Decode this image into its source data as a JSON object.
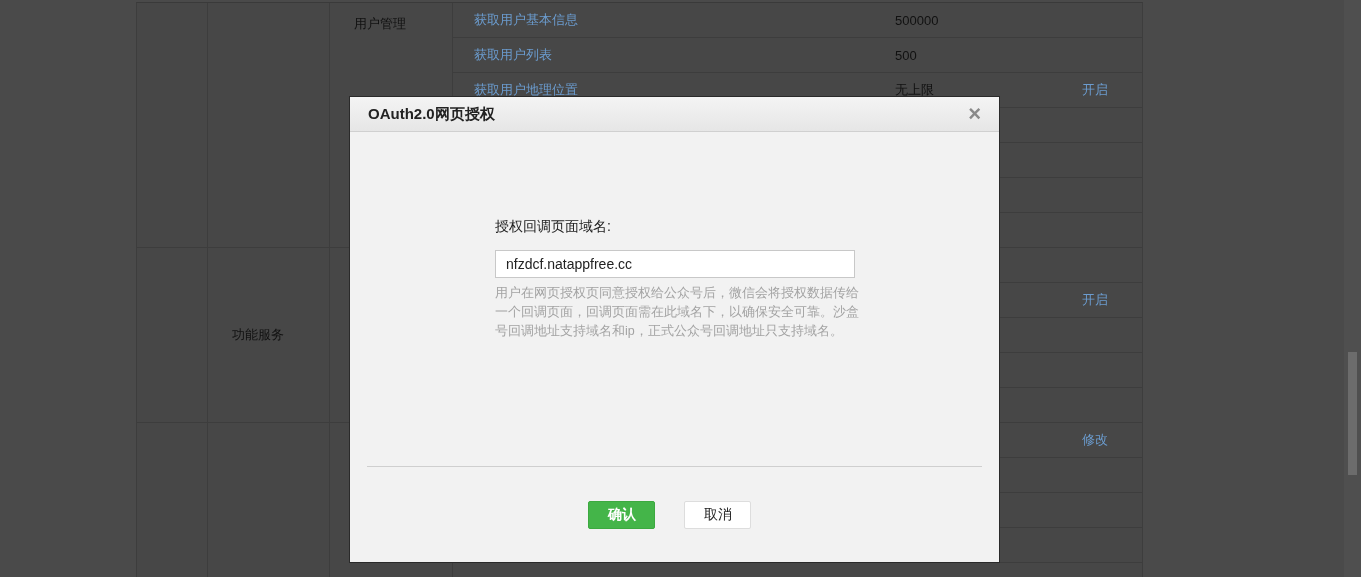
{
  "feature_table": {
    "sections": [
      {
        "subsections": [
          {
            "name": "用户管理",
            "rows": [
              {
                "api": "获取用户基本信息",
                "limit": "500000"
              },
              {
                "api": "获取用户列表",
                "limit": "500"
              },
              {
                "api": "获取用户地理位置",
                "limit": "无上限",
                "action": "开启"
              },
              {},
              {},
              {},
              {}
            ]
          }
        ]
      },
      {
        "category": "功能服务",
        "subsections": [
          {
            "rows": [
              {},
              {
                "action": "开启"
              },
              {},
              {},
              {}
            ]
          }
        ]
      },
      {
        "subsections": [
          {
            "rows": [
              {
                "action": "修改"
              },
              {},
              {},
              {},
              {}
            ]
          }
        ]
      }
    ]
  },
  "dialog": {
    "title": "OAuth2.0网页授权",
    "close": "×",
    "field_label": "授权回调页面域名:",
    "field_value": "nfzdcf.natappfree.cc",
    "hint": "用户在网页授权页同意授权给公众号后，微信会将授权数据传给一个回调页面，回调页面需在此域名下，以确保安全可靠。沙盒号回调地址支持域名和ip，正式公众号回调地址只支持域名。",
    "buttons": [
      {
        "label": "确认",
        "kind": "primary"
      },
      {
        "label": "取消",
        "kind": "secondary"
      }
    ]
  }
}
